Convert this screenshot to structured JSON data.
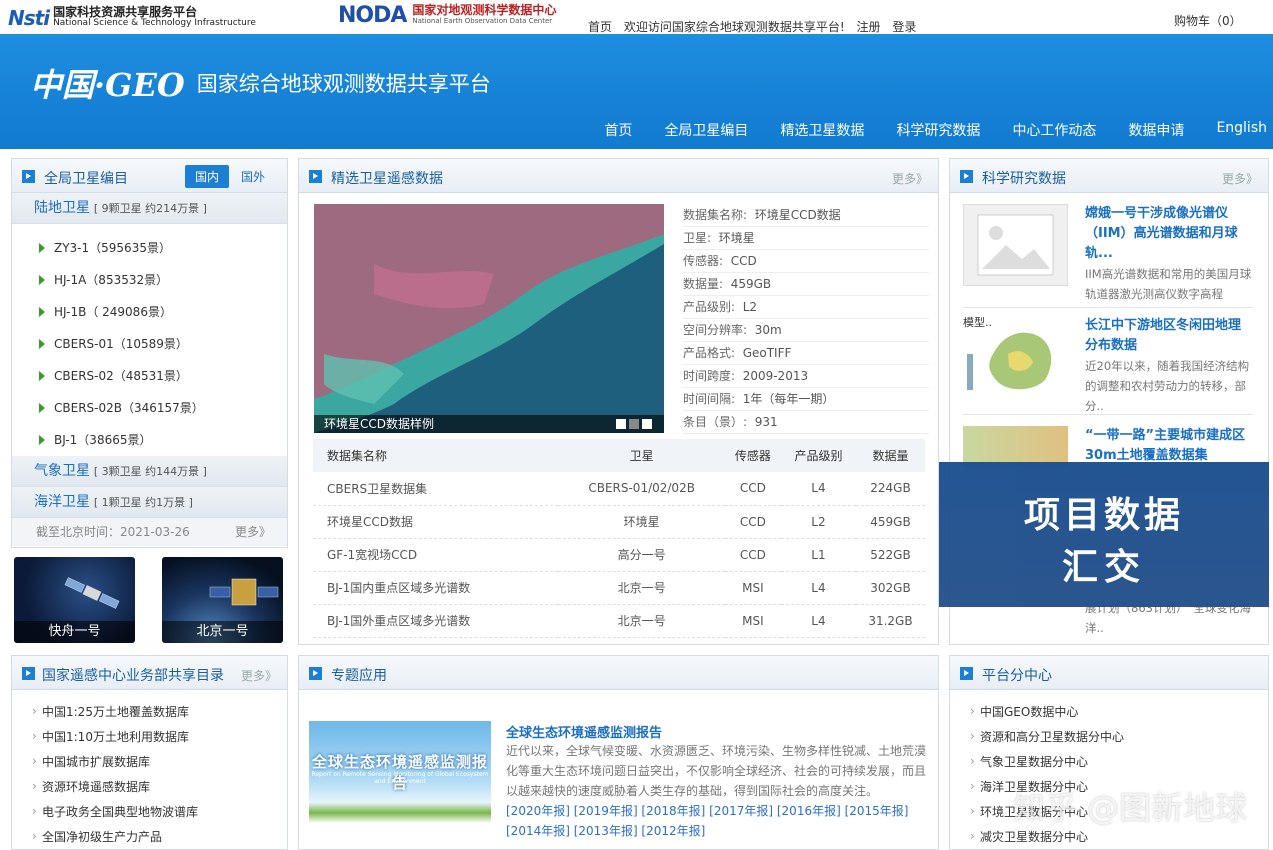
{
  "topbar": {
    "nsti_logo_word": "Nsti",
    "nsti_cn": "国家科技资源共享服务平台",
    "nsti_en": "National Science & Technology Infrastructure",
    "noda_logo_word": "NODA",
    "noda_cn": "国家对地观测科学数据中心",
    "noda_en": "National Earth Observation Data Center",
    "links": [
      "首页",
      "欢迎访问国家综合地球观测数据共享平台!",
      "注册",
      "登录"
    ],
    "cart": "购物车（0）"
  },
  "header": {
    "logo_mark": "中国·GEO",
    "title": "国家综合地球观测数据共享平台",
    "nav": [
      "首页",
      "全局卫星编目",
      "精选卫星数据",
      "科学研究数据",
      "中心工作动态",
      "数据申请",
      "English"
    ]
  },
  "catalog": {
    "title": "全局卫星编目",
    "tabs": [
      "国内",
      "国外"
    ],
    "land": {
      "name": "陆地卫星",
      "info": "[ 9颗卫星 约214万景 ]"
    },
    "satellites": [
      "ZY3-1（595635景）",
      "HJ-1A（853532景）",
      "HJ-1B（ 249086景）",
      "CBERS-01（10589景）",
      "CBERS-02（48531景）",
      "CBERS-02B（346157景）",
      "BJ-1（38665景）"
    ],
    "weather": {
      "name": "气象卫星",
      "info": "[ 3颗卫星 约144万景 ]"
    },
    "ocean": {
      "name": "海洋卫星",
      "info": "[ 1颗卫星 约1万景 ]"
    },
    "deadline": "截至北京时间：2021-03-26",
    "more": "更多》",
    "tiles": [
      "快舟一号",
      "北京一号"
    ]
  },
  "featured": {
    "title": "精选卫星遥感数据",
    "more": "更多》",
    "caption": "环境星CCD数据样例",
    "info": [
      {
        "k": "数据集名称:",
        "v": "环境星CCD数据"
      },
      {
        "k": "卫星:",
        "v": "环境星"
      },
      {
        "k": "传感器:",
        "v": "CCD"
      },
      {
        "k": "数据量:",
        "v": "459GB"
      },
      {
        "k": "产品级别:",
        "v": "L2"
      },
      {
        "k": "空间分辨率:",
        "v": "30m"
      },
      {
        "k": "产品格式:",
        "v": "GeoTIFF"
      },
      {
        "k": "时间跨度:",
        "v": "2009-2013"
      },
      {
        "k": "时间间隔:",
        "v": "1年（每年一期）"
      },
      {
        "k": "条目（景）:",
        "v": "931"
      }
    ],
    "table_headers": [
      "数据集名称",
      "卫星",
      "传感器",
      "产品级别",
      "数据量"
    ],
    "table_rows": [
      [
        "CBERS卫星数据集",
        "CBERS-01/02/02B",
        "CCD",
        "L4",
        "224GB"
      ],
      [
        "环境星CCD数据",
        "环境星",
        "CCD",
        "L2",
        "459GB"
      ],
      [
        "GF-1宽视场CCD",
        "高分一号",
        "CCD",
        "L1",
        "522GB"
      ],
      [
        "BJ-1国内重点区域多光谱数",
        "北京一号",
        "MSI",
        "L4",
        "302GB"
      ],
      [
        "BJ-1国外重点区域多光谱数",
        "北京一号",
        "MSI",
        "L4",
        "31.2GB"
      ]
    ]
  },
  "science": {
    "title": "科学研究数据",
    "more": "更多》",
    "items": [
      {
        "title": "嫦娥一号干涉成像光谱仪（IIM）高光谱数据和月球轨...",
        "desc": "IIM高光谱数据和常用的美国月球轨道器激光测高仪数字高程"
      },
      {
        "title": "长江中下游地区冬闲田地理分布数据",
        "desc": "近20年以来，随着我国经济结构的调整和农村劳动力的转移，部分..",
        "thumb_label": "模型.."
      },
      {
        "title": "“一带一路”主要城市建成区30m土地覆盖数据集",
        "desc": "展计划（863计划）“全球变化海洋.."
      }
    ],
    "overlay_line1": "项目数据",
    "overlay_line2": "汇交"
  },
  "remote": {
    "title": "国家遥感中心业务部共享目录",
    "more": "更多》",
    "items": [
      "中国1:25万土地覆盖数据库",
      "中国1:10万土地利用数据库",
      "中国城市扩展数据库",
      "资源环境遥感数据库",
      "电子政务全国典型地物波谱库",
      "全国净初级生产力产品"
    ]
  },
  "special": {
    "title": "专题应用",
    "report_image_title": "全球生态环境遥感监测报告",
    "report_image_sub": "Report on Remote Sensing Monitoring of Global Ecosystem and Environment",
    "report_title": "全球生态环境遥感监测报告",
    "report_desc": "近代以来，全球气候变暖、水资源匮乏、环境污染、生物多样性锐减、土地荒漠化等重大生态环境问题日益突出，不仅影响全球经济、社会的可持续发展，而且以越来越快的速度威胁着人类生存的基础，得到国际社会的高度关注。",
    "report_links": "[2020年报] [2019年报] [2018年报] [2017年报] [2016年报] [2015年报] [2014年报] [2013年报] [2012年报]"
  },
  "subcenters": {
    "title": "平台分中心",
    "items": [
      "中国GEO数据中心",
      "资源和高分卫星数据分中心",
      "气象卫星数据分中心",
      "海洋卫星数据分中心",
      "环境卫星数据分中心",
      "减灾卫星数据分中心"
    ]
  },
  "watermark": "知乎 @图新地球"
}
